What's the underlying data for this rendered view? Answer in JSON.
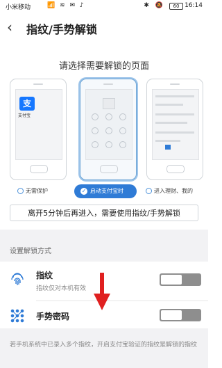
{
  "status_bar": {
    "carrier": "小米移动",
    "signal_icons": "📶 ≋ ✉ ♪",
    "system_icons": "✱ 🔕",
    "battery": "60",
    "time": "16:14"
  },
  "header": {
    "title": "指纹/手势解锁"
  },
  "prompt": "请选择需要解锁的页面",
  "phones": {
    "left": {
      "app_icon_glyph": "支",
      "app_label": "支付宝"
    }
  },
  "options": [
    {
      "label": "无需保护",
      "selected": false
    },
    {
      "label": "启动支付宝时",
      "selected": true
    },
    {
      "label": "进入理财、我的",
      "selected": false
    }
  ],
  "info_box": "离开5分钟后再进入，需要使用指纹/手势解锁",
  "section_label": "设置解锁方式",
  "methods": [
    {
      "label": "指纹",
      "sub": "指纹仅对本机有效",
      "icon": "fingerprint-icon",
      "enabled": false
    },
    {
      "label": "手势密码",
      "icon": "gesture-pattern-icon",
      "enabled": false
    }
  ],
  "footer": "若手机系统中已录入多个指纹，开启支付宝验证的指纹是解锁的指纹",
  "colors": {
    "accent": "#2f7bd6",
    "alipay": "#1677ff",
    "arrow": "#e02020"
  }
}
